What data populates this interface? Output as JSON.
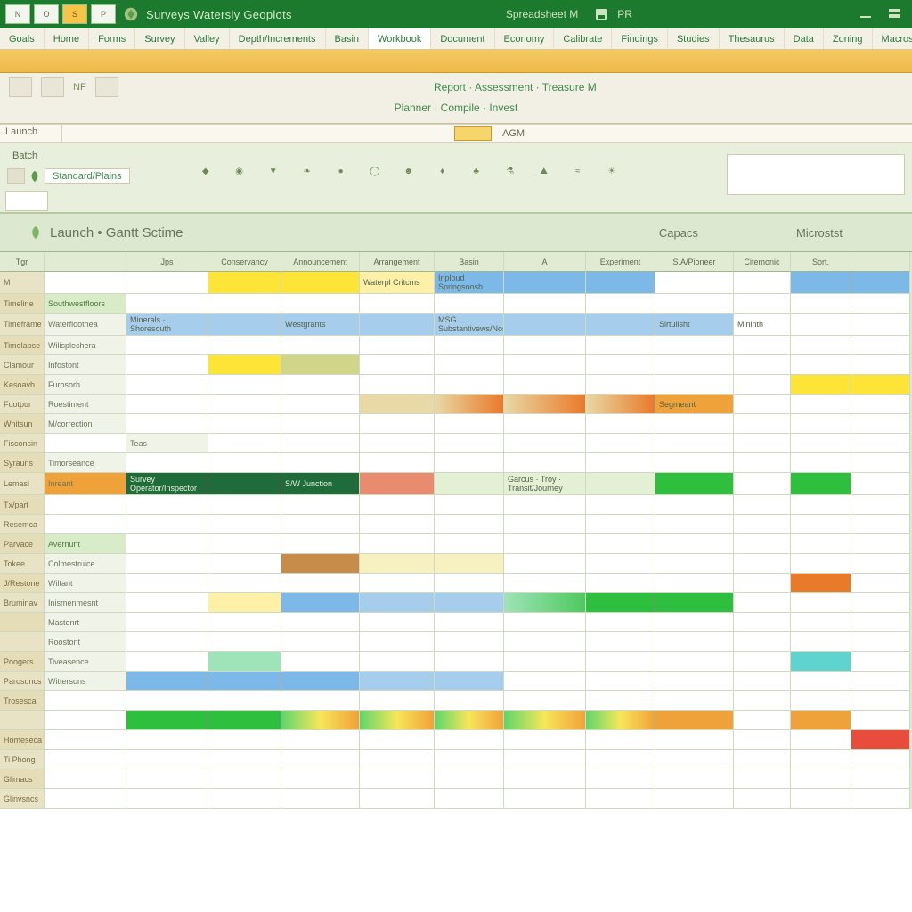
{
  "titlebar": {
    "btn_new": "N",
    "btn_open": "O",
    "btn_save": "S",
    "btn_print": "P",
    "app_title": "Surveys Watersly Geoplots",
    "mid_label": "Spreadsheet M",
    "mid_code": "PR"
  },
  "tabs": [
    "Goals",
    "Home",
    "Forms",
    "Survey",
    "Valley",
    "Depth/Increments",
    "Basin",
    "Workbook",
    "Document",
    "Economy",
    "Calibrate",
    "Findings",
    "Studies",
    "Thesaurus",
    "Data",
    "Zoning",
    "Macros"
  ],
  "ribbon": {
    "center1": "Report · Assessment · Treasure M",
    "center2": "Planner · Compile · Invest",
    "namebox": "Launch",
    "cell_lbl": "AGM",
    "batch": "Batch",
    "pill": "Standard/Plains",
    "icons": [
      "shield-icon",
      "pin-icon",
      "filter-icon",
      "leaf-icon",
      "circle-icon",
      "ring-icon",
      "user-icon",
      "drop-icon",
      "tree-icon",
      "flask-icon",
      "hills-icon",
      "wave-icon",
      "sun-icon"
    ]
  },
  "section": {
    "title": "Launch • Gantt Sctime",
    "h2": "Capacs",
    "h3": "Microstst"
  },
  "columns": [
    "Tgr",
    "",
    "Jps",
    "Conservancy",
    "Announcement",
    "Arrangement",
    "Basin",
    "A",
    "Experiment",
    "S.A/Pioneer",
    "Citemonic",
    "Sort.",
    ""
  ],
  "rowheads": [
    "M",
    "Timeline",
    "Timeframe",
    "Timelapse",
    "Clamour",
    "Kesoavh",
    "Footpur",
    "Whitsun",
    "Fisconsin",
    "Syrauns",
    "Lemasi",
    "Tx/part",
    "Resemca",
    "Parvace",
    "Tokee",
    "J/Restone",
    "Bruminav",
    "",
    "",
    "Poogers",
    "Parosuncs",
    "Trosesca",
    "",
    "Homeseca",
    "Ti Phong",
    "Glimacs",
    "Glinvsncs"
  ],
  "rowlabels": {
    "1": {
      "c2": "Southwestfloors"
    },
    "2": {
      "c2": "Waterfloothea",
      "c3": "Minerals · Shoresouth",
      "c5": "Westgrants"
    },
    "3": {
      "c2": "Wilisplechera"
    },
    "4": {
      "c2": "Infostont"
    },
    "5": {
      "c2": "Furosorh"
    },
    "6": {
      "c2": "Roestiment"
    },
    "7": {
      "c2": "M/correction"
    },
    "8": {
      "c3": "Teas"
    },
    "9": {
      "c2": "Timorseance"
    },
    "10": {
      "c2": "Inreant",
      "c3": "Survey Operator/Inspector",
      "c4": "S/W Junction"
    },
    "13": {
      "c2": "Avernunt"
    },
    "14": {
      "c2": "Colmestruice"
    },
    "15": {
      "c2": "Wiltant"
    },
    "16": {
      "c2": "Inismenmesnt"
    },
    "17": {
      "c2": "Mastenrt"
    },
    "18": {
      "c2": "Roostont"
    },
    "19": {
      "c2": "Tiveasence"
    },
    "20": {
      "c2": "Wittersons"
    }
  },
  "notes": {
    "r0c5": "Waterpl  Critcms",
    "r0c6": "Inploud  Springsoosh",
    "r2c7": "MSG · Substantivews/Nosterm",
    "r2c10": "Sirtulisht",
    "r2c11": "Mininth",
    "r6c10": "Segmeant",
    "r10c7": "Garcus · Troy · Transit/Journey"
  }
}
